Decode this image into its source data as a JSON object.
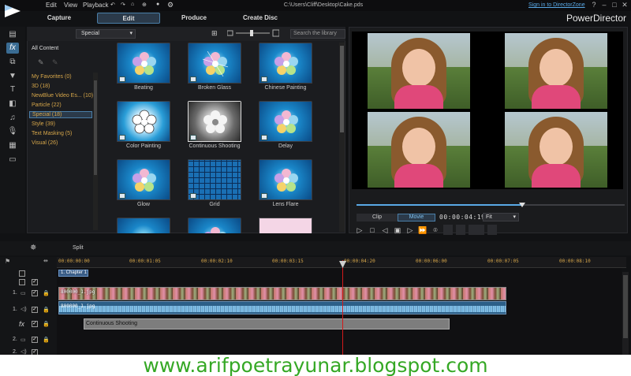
{
  "menu": {
    "edit": "Edit",
    "view": "View",
    "playback": "Playback"
  },
  "window": {
    "file_path": "C:\\Users\\Cliff\\Desktop\\Cake.pds",
    "sign_in": "Sign in to DirectorZone",
    "brand": "PowerDirector"
  },
  "modes": {
    "capture": "Capture",
    "edit": "Edit",
    "produce": "Produce",
    "create_disc": "Create Disc"
  },
  "library": {
    "category": "Special",
    "search_placeholder": "Search the library",
    "tree_root": "All Content",
    "tree": [
      {
        "label": "My Favorites  (0)"
      },
      {
        "label": "3D  (18)"
      },
      {
        "label": "NewBlue Video Es...  (10)"
      },
      {
        "label": "Particle  (22)"
      },
      {
        "label": "Special  (18)"
      },
      {
        "label": "Style  (39)"
      },
      {
        "label": "Text Masking  (5)"
      },
      {
        "label": "Visual  (26)"
      }
    ],
    "effects": [
      "Beating",
      "Broken Glass",
      "Chinese Painting",
      "Color Painting",
      "Continuous Shooting",
      "Delay",
      "Glow",
      "Grid",
      "Lens Flare"
    ]
  },
  "preview": {
    "clip_label": "Clip",
    "movie_label": "Movie",
    "timecode": "00:00:04:19",
    "fit": "Fit"
  },
  "timeline": {
    "split_label": "Split",
    "ruler": [
      "00:00:00:00",
      "00:00:01:05",
      "00:00:02:10",
      "00:00:03:15",
      "00:00:04:20",
      "00:00:06:00",
      "00:00:07:05",
      "00:00:08:10"
    ],
    "chapter": "1. Chapter 1",
    "video_clip": "800000_1.jpg",
    "audio_clip": "800000_1.jpg",
    "fx_clip": "Continuous Shooting",
    "track1_label": "1.",
    "track1a_label": "1.",
    "track2_label": "2.",
    "track2a_label": "2."
  },
  "watermark": "www.arifpoetrayunar.blogspot.com",
  "colors": {
    "accent": "#4a7ea8",
    "tree_text": "#d6a64a",
    "playhead": "#d21a1a",
    "watermark": "#35a825"
  }
}
